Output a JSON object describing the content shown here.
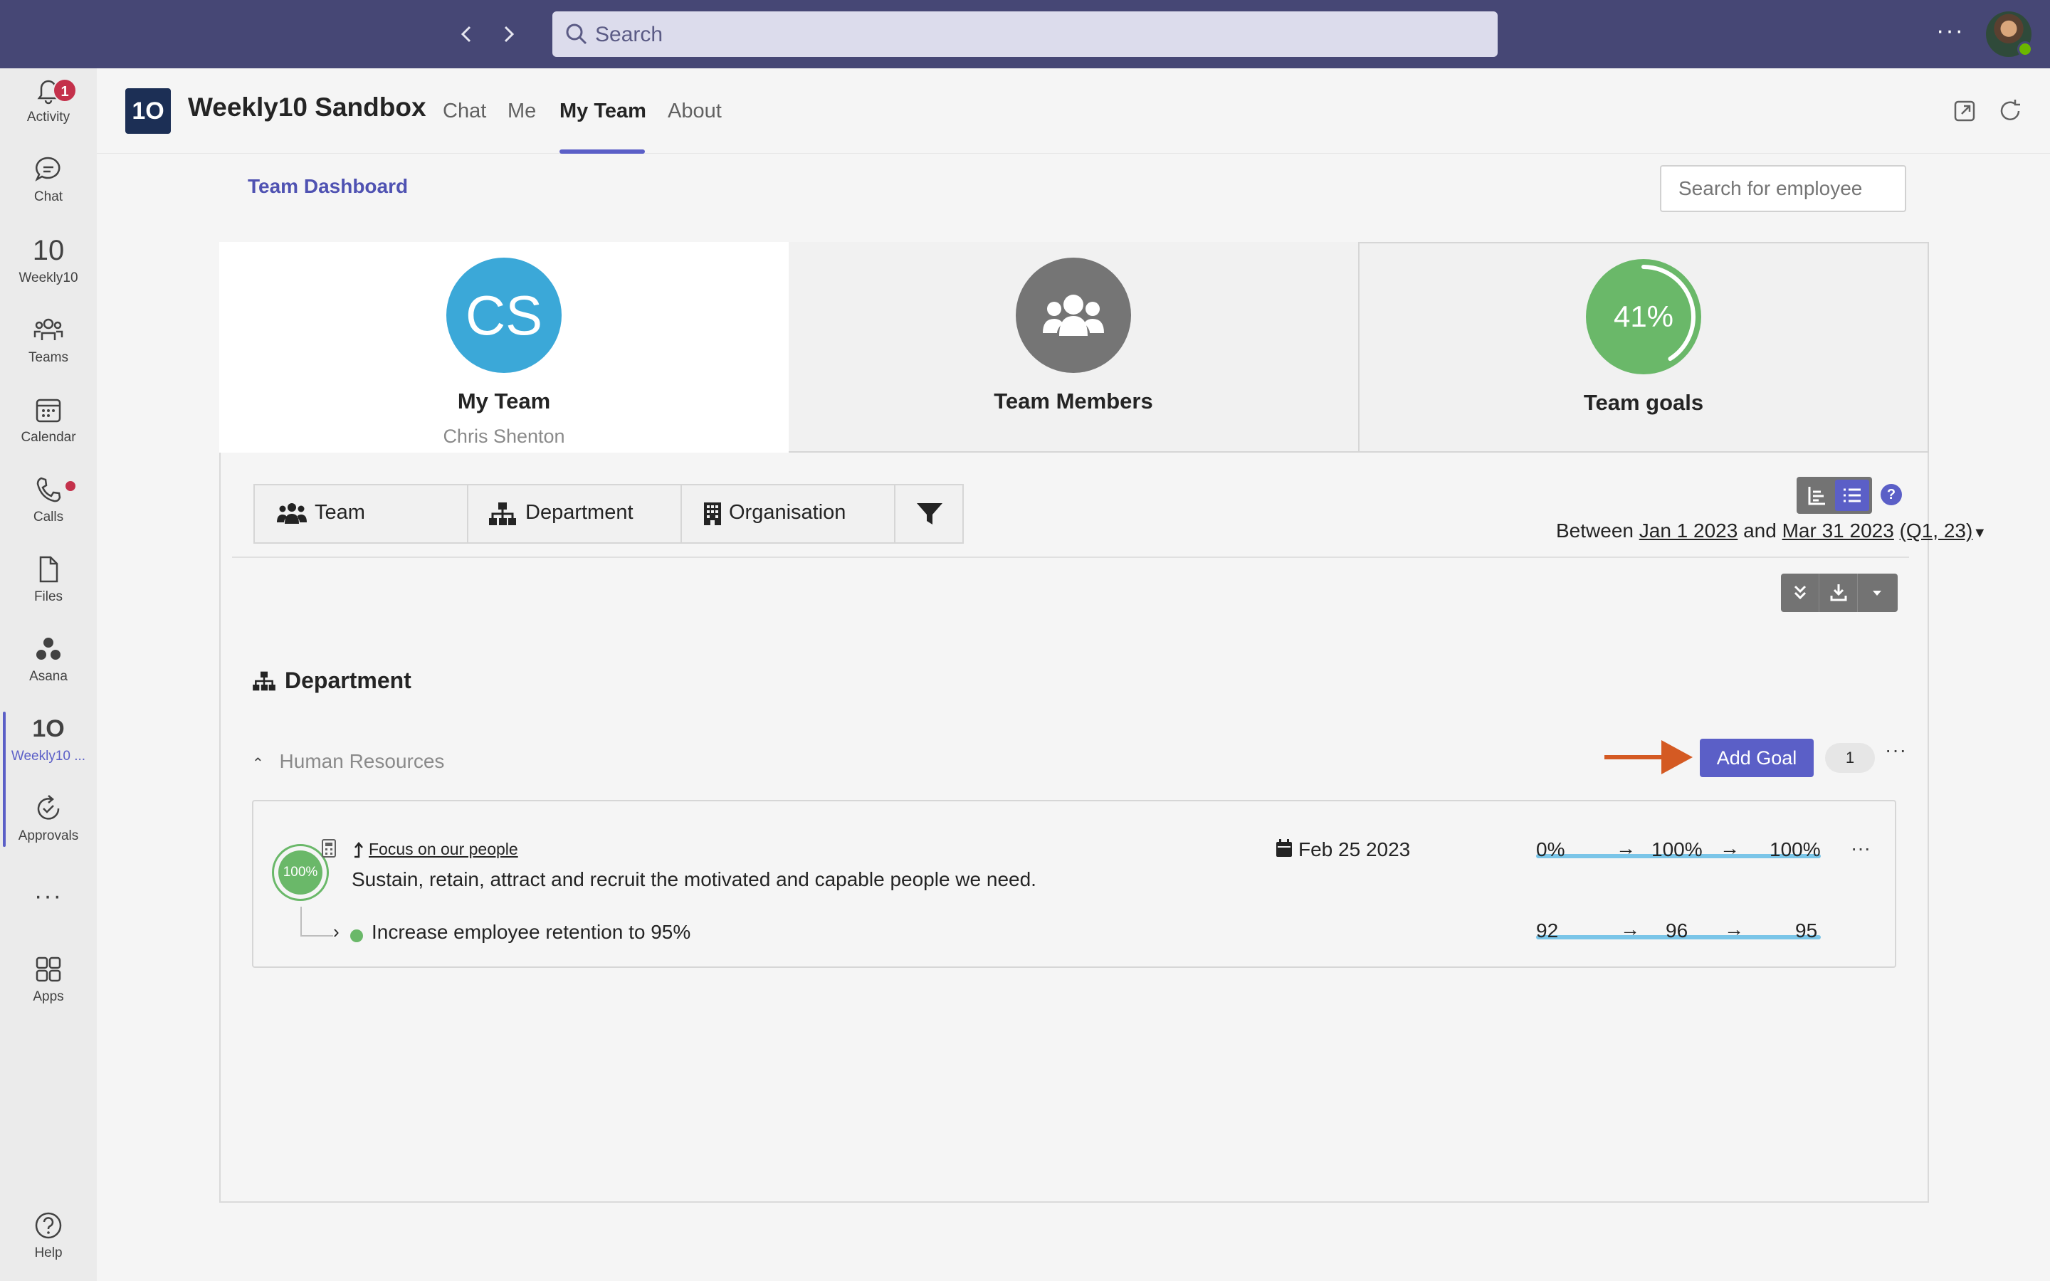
{
  "topbar": {
    "search_placeholder": "Search",
    "more_label": "···",
    "back_icon": "chevron-left-icon",
    "forward_icon": "chevron-right-icon"
  },
  "rail": {
    "items": [
      {
        "label": "Activity",
        "badge": "1"
      },
      {
        "label": "Chat"
      },
      {
        "label": "Weekly10"
      },
      {
        "label": "Teams"
      },
      {
        "label": "Calendar"
      },
      {
        "label": "Calls"
      },
      {
        "label": "Files"
      },
      {
        "label": "Asana"
      },
      {
        "label": "Weekly10 ..."
      },
      {
        "label": "Approvals"
      },
      {
        "label": "···"
      },
      {
        "label": "Apps"
      },
      {
        "label": "Help"
      }
    ],
    "logo_text": "10",
    "active_logo_text": "1O"
  },
  "app": {
    "logo": "1O",
    "title": "Weekly10 Sandbox",
    "tabs": [
      "Chat",
      "Me",
      "My Team",
      "About"
    ],
    "active_tab": "My Team"
  },
  "dashboard": {
    "link": "Team Dashboard",
    "search_placeholder": "Search for employee",
    "cards": [
      {
        "initials": "CS",
        "title": "My Team",
        "subtitle": "Chris Shenton"
      },
      {
        "title": "Team Members"
      },
      {
        "percent_label": "41%",
        "percent": 41,
        "title": "Team goals"
      }
    ],
    "filters": [
      "Team",
      "Department",
      "Organisation"
    ],
    "date_range": {
      "prefix": "Between",
      "start": "Jan 1 2023",
      "joiner": "and",
      "end": "Mar 31 2023",
      "quarter": "(Q1, 23)"
    },
    "help": "?",
    "section_title": "Department",
    "group": {
      "name": "Human Resources",
      "add_goal": "Add Goal",
      "count": "1",
      "more": "···"
    },
    "goal": {
      "progress_label": "100%",
      "link": "Focus on our people",
      "description": "Sustain, retain, attract and recruit the motivated and capable people we need.",
      "date": "Feb 25 2023",
      "start": "0%",
      "current": "100%",
      "target": "100%",
      "more": "···",
      "sub": {
        "description": "Increase employee retention to 95%",
        "start": "92",
        "current": "96",
        "target": "95"
      }
    }
  },
  "colors": {
    "topbar": "#464775",
    "accent": "#5b5fc7",
    "success": "#6ab869",
    "annotation_arrow": "#d45a23",
    "avatar_blue": "#3ba8d8"
  }
}
